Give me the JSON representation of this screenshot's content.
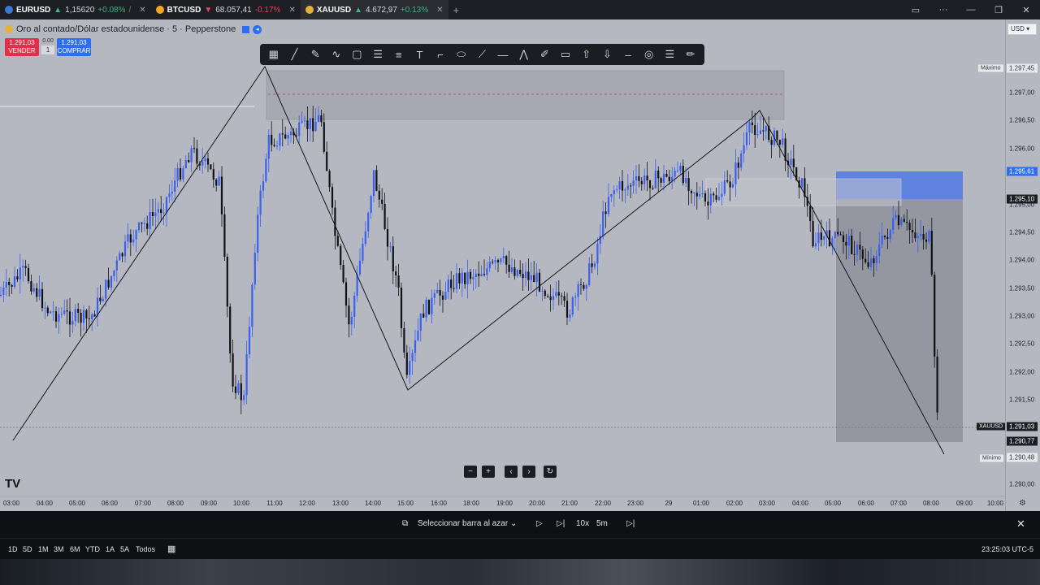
{
  "tabs": [
    {
      "symbol": "EURUSD",
      "arrow": "▲",
      "price": "1,15620",
      "change": "+0.08%",
      "trend": "up",
      "suffix": "/",
      "coin_color": "#3a78d6"
    },
    {
      "symbol": "BTCUSD",
      "arrow": "▼",
      "price": "68.057,41",
      "change": "-0.17%",
      "trend": "down",
      "suffix": "",
      "coin_color": "#f5a623"
    },
    {
      "symbol": "XAUUSD",
      "arrow": "▲",
      "price": "4.672,97",
      "change": "+0.13%",
      "trend": "up",
      "suffix": "",
      "coin_color": "#e2b23c"
    }
  ],
  "new_tab_icon": "plus-icon",
  "chart": {
    "title": "Oro al contado/Dólar estadounidense · 5 · Pepperstone",
    "currency": "USD",
    "sell": {
      "price": "1.291,03",
      "label": "VENDER"
    },
    "buy": {
      "price": "1.291,03",
      "label": "COMPRAR"
    },
    "spread": "0.00",
    "spread_qty": "1",
    "current_price_tag": "1.291,03",
    "current_symbol_tag": "XAUUSD",
    "max_label": "Máximo",
    "min_label": "Mínimo",
    "tags": [
      {
        "text": "1.297,45",
        "kind": "max"
      },
      {
        "text": "1.295,61",
        "kind": "blue"
      },
      {
        "text": "1.295,10",
        "kind": "dark"
      },
      {
        "text": "1.291,03",
        "kind": "current"
      },
      {
        "text": "1.290,77",
        "kind": "dark"
      },
      {
        "text": "1.290,48",
        "kind": "min"
      }
    ],
    "price_axis": [
      "1.297,00",
      "1.296,50",
      "1.296,00",
      "1.295,00",
      "1.294,50",
      "1.294,00",
      "1.293,50",
      "1.293,00",
      "1.292,50",
      "1.292,00",
      "1.291,50",
      "1.290,00"
    ],
    "time_axis": [
      "03:00",
      "04:00",
      "05:00",
      "06:00",
      "07:00",
      "08:00",
      "09:00",
      "10:00",
      "11:00",
      "12:00",
      "13:00",
      "14:00",
      "15:00",
      "16:00",
      "18:00",
      "19:00",
      "20:00",
      "21:00",
      "22:00",
      "23:00",
      "29",
      "01:00",
      "02:00",
      "03:00",
      "04:00",
      "05:00",
      "06:00",
      "07:00",
      "08:00",
      "09:00",
      "10:00"
    ]
  },
  "toolbar_icons": [
    "grid-icon",
    "line-icon",
    "brush-icon",
    "wave-icon",
    "rectangle-icon",
    "fib-icon",
    "channel-icon",
    "text-icon",
    "path-icon",
    "ellipse-icon",
    "ray-icon",
    "hline-icon",
    "pattern-icon",
    "pen-icon",
    "comment-icon",
    "arrow-up-icon",
    "arrow-down-icon",
    "dash-icon",
    "circle-target-icon",
    "menu-icon",
    "pencil-icon"
  ],
  "zoom": {
    "minus": "−",
    "plus": "+",
    "prev": "‹",
    "next": "›",
    "reset": "↻"
  },
  "replay": {
    "select_bar": "Seleccionar barra al azar",
    "speed": "10x",
    "interval": "5m"
  },
  "periods": [
    "1D",
    "5D",
    "1M",
    "3M",
    "6M",
    "YTD",
    "1A",
    "5A",
    "Todos"
  ],
  "clock": "23:25:03 UTC-5",
  "logo": "TV"
}
